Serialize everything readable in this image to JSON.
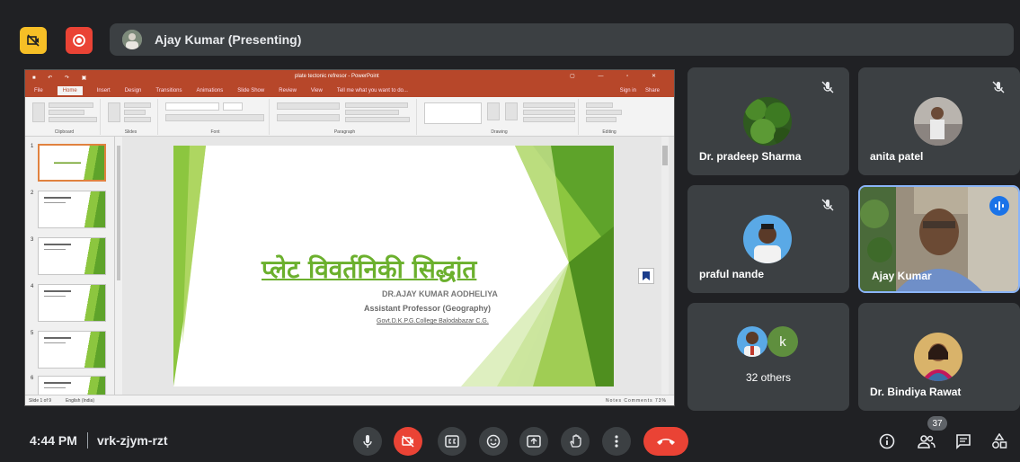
{
  "presenter_bar": {
    "name": "Ajay Kumar (Presenting)"
  },
  "powerpoint": {
    "window_title": "plate tectonic refresor - PowerPoint",
    "tabs": [
      "File",
      "Home",
      "Insert",
      "Design",
      "Transitions",
      "Animations",
      "Slide Show",
      "Review",
      "View",
      "Tell me what you want to do..."
    ],
    "account": "Sign in",
    "share": "Share",
    "ribbon_groups": [
      "Clipboard",
      "Slides",
      "Font",
      "Paragraph",
      "Drawing",
      "Editing"
    ],
    "thumb_numbers": [
      "1",
      "2",
      "3",
      "4",
      "5",
      "6"
    ],
    "status_left": "Slide 1 of 9",
    "status_lang": "English (India)",
    "status_right": "Notes   Comments   73%"
  },
  "slide": {
    "title": "प्लेट विवर्तनिकी सिद्धांत",
    "author": "DR.AJAY KUMAR AODHELIYA",
    "role": "Assistant Professor (Geography)",
    "college": "Govt.D.K.P.G.College Balodabazar C.G.",
    "accent_color": "#6bb02d"
  },
  "participants": [
    {
      "name": "Dr. pradeep Sharma",
      "muted": true
    },
    {
      "name": "anita patel",
      "muted": true
    },
    {
      "name": "praful nande",
      "muted": true
    },
    {
      "name": "Ajay Kumar",
      "speaking": true
    },
    {
      "name": "32 others",
      "letter": "k"
    },
    {
      "name": "Dr. Bindiya Rawat"
    }
  ],
  "meeting": {
    "time": "4:44 PM",
    "code": "vrk-zjym-rzt",
    "participant_count": "37"
  },
  "icons": [
    "camera-off-icon",
    "record-icon",
    "mic-icon",
    "camera-off-icon",
    "captions-icon",
    "emoji-icon",
    "present-icon",
    "raise-hand-icon",
    "more-icon",
    "end-call-icon",
    "info-icon",
    "people-icon",
    "chat-icon",
    "activities-icon"
  ]
}
